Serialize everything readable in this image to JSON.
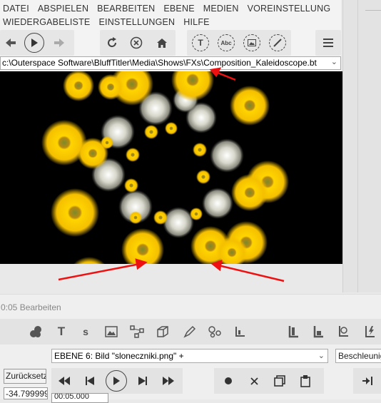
{
  "menu_row1": [
    "DATEI",
    "ABSPIELEN",
    "BEARBEITEN",
    "EBENE",
    "MEDIEN",
    "VOREINSTELLUNG"
  ],
  "menu_row2": [
    "WIEDERGABELISTE",
    "EINSTELLUNGEN",
    "HILFE"
  ],
  "toolbar": {
    "text_button": "T",
    "abc_button": "Abc"
  },
  "path": "c:\\Outerspace Software\\BluffTitler\\Media\\Shows\\FXs\\Composition_Kaleidoscope.bt",
  "timeline_label": "0:05 Bearbeiten",
  "tools": {
    "text_tool": "T",
    "s_tool": "s"
  },
  "layer_select": "EBENE 6: Bild \"sloneczniki.png\" +",
  "accel_select": "Beschleunigen",
  "reset_label": "Zurücksetzen",
  "value_field": "-34.799999",
  "time_field": "00:05.000",
  "colors": {
    "accent_red": "#ee1111",
    "preview_bg": "#000000",
    "sunflower": "#f5c400"
  }
}
